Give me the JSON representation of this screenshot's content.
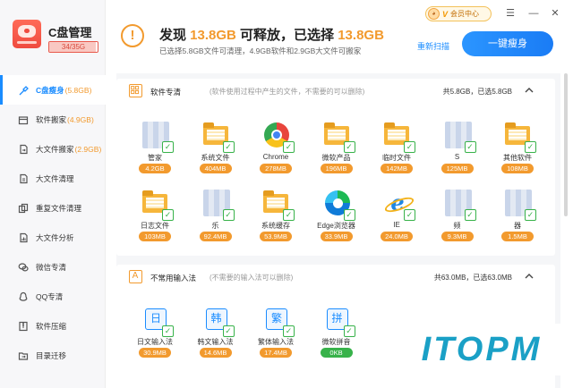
{
  "app": {
    "title": "C盘管理",
    "usage_text": "34/35G",
    "usage_fraction": 0.97
  },
  "sidebar": {
    "items": [
      {
        "label": "C盘瘦身",
        "size": "(5.8GB)",
        "icon": "broom-icon",
        "active": true
      },
      {
        "label": "软件搬家",
        "size": "(4.9GB)",
        "icon": "box-icon",
        "active": false
      },
      {
        "label": "大文件搬家",
        "size": "(2.9GB)",
        "icon": "file-move-icon",
        "active": false
      },
      {
        "label": "大文件清理",
        "size": "",
        "icon": "file-clean-icon",
        "active": false
      },
      {
        "label": "重复文件清理",
        "size": "",
        "icon": "duplicate-icon",
        "active": false
      },
      {
        "label": "大文件分析",
        "size": "",
        "icon": "analysis-icon",
        "active": false
      },
      {
        "label": "微信专清",
        "size": "",
        "icon": "wechat-icon",
        "active": false
      },
      {
        "label": "QQ专清",
        "size": "",
        "icon": "qq-icon",
        "active": false
      },
      {
        "label": "软件压缩",
        "size": "",
        "icon": "compress-icon",
        "active": false
      },
      {
        "label": "目录迁移",
        "size": "",
        "icon": "folder-move-icon",
        "active": false
      }
    ]
  },
  "header": {
    "headline_prefix": "发现 ",
    "releasable": "13.8GB",
    "headline_mid": " 可释放，已选择 ",
    "selected": "13.8GB",
    "subline": "已选择5.8GB文件可清理，4.9GB软件和2.9GB大文件可搬家",
    "rescan": "重新扫描",
    "slim_button": "一键瘦身",
    "vip_badge": "V",
    "vip_text": "会员中心",
    "menu_icon": "☰",
    "min_icon": "—",
    "close_icon": "✕"
  },
  "sections": [
    {
      "title": "软件专清",
      "desc": "(软件使用过程中产生的文件，不需要的可以删除)",
      "stats": "共5.8GB，已选5.8GB",
      "tiles": [
        {
          "label": "管家",
          "size": "4.2GB",
          "icon": "blurred-app-icon",
          "kind": "blurred"
        },
        {
          "label": "系统文件",
          "size": "404MB",
          "icon": "folder-icon",
          "kind": "folder"
        },
        {
          "label": "Chrome",
          "size": "278MB",
          "icon": "chrome-icon",
          "kind": "chrome"
        },
        {
          "label": "微软产品",
          "size": "196MB",
          "icon": "folder-icon",
          "kind": "folder"
        },
        {
          "label": "临时文件",
          "size": "142MB",
          "icon": "folder-icon",
          "kind": "folder"
        },
        {
          "label": "S",
          "size": "125MB",
          "icon": "blurred-app-icon",
          "kind": "blurred"
        },
        {
          "label": "其他软件",
          "size": "108MB",
          "icon": "folder-icon",
          "kind": "folder"
        },
        {
          "label": "日志文件",
          "size": "103MB",
          "icon": "folder-icon",
          "kind": "folder"
        },
        {
          "label": "乐",
          "size": "92.4MB",
          "icon": "blurred-app-icon",
          "kind": "blurred"
        },
        {
          "label": "系统缓存",
          "size": "53.9MB",
          "icon": "folder-icon",
          "kind": "folder"
        },
        {
          "label": "Edge浏览器",
          "size": "33.9MB",
          "icon": "edge-icon",
          "kind": "edge"
        },
        {
          "label": "IE",
          "size": "24.0MB",
          "icon": "ie-icon",
          "kind": "ie"
        },
        {
          "label": "频",
          "size": "9.3MB",
          "icon": "blurred-app-icon",
          "kind": "blurred"
        },
        {
          "label": "器",
          "size": "1.5MB",
          "icon": "blurred-app-icon",
          "kind": "blurred"
        }
      ]
    },
    {
      "title": "不常用输入法",
      "desc": "(不需要的输入法可以删除)",
      "stats": "共63.0MB，已选63.0MB",
      "tiles": [
        {
          "label": "日文输入法",
          "size": "30.9MB",
          "icon": "ime-icon",
          "kind": "ime",
          "glyph": "日"
        },
        {
          "label": "韩文输入法",
          "size": "14.6MB",
          "icon": "ime-icon",
          "kind": "ime",
          "glyph": "韩"
        },
        {
          "label": "繁体输入法",
          "size": "17.4MB",
          "icon": "ime-icon",
          "kind": "ime",
          "glyph": "繁"
        },
        {
          "label": "微软拼音",
          "size": "0KB",
          "icon": "ime-icon",
          "kind": "ime",
          "glyph": "拼",
          "size_color": "green"
        }
      ]
    }
  ],
  "watermark": "ITOPM",
  "colors": {
    "accent": "#1a8cff",
    "highlight": "#f29a2e",
    "ok": "#38b24a"
  }
}
